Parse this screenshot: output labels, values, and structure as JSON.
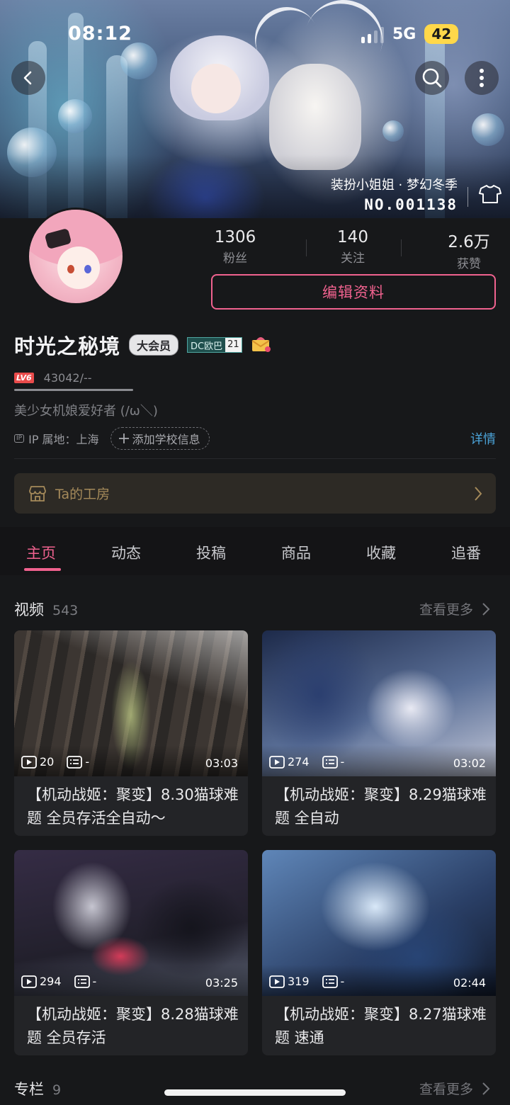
{
  "status": {
    "time": "08:12",
    "network": "5G",
    "battery": "42"
  },
  "costume": {
    "name": "装扮小姐姐 · 梦幻冬季",
    "number": "NO.001138"
  },
  "stats": [
    {
      "value": "1306",
      "label": "粉丝"
    },
    {
      "value": "140",
      "label": "关注"
    },
    {
      "value": "2.6万",
      "label": "获赞"
    }
  ],
  "edit_button": "编辑资料",
  "user": {
    "name": "时光之秘境",
    "vip_badge": "大会员",
    "dc_label": "DC欧巴",
    "dc_number": "21",
    "level": "LV6",
    "exp": "43042/--",
    "signature": "美少女机娘爱好者 (/ω＼)",
    "ip_badge": "IP",
    "ip_location": "IP 属地：上海",
    "school_button": "添加学校信息",
    "detail_link": "详情"
  },
  "workshop": {
    "label": "Ta的工房"
  },
  "tabs": [
    "主页",
    "动态",
    "投稿",
    "商品",
    "收藏",
    "追番"
  ],
  "active_tab": 0,
  "videos_section": {
    "title": "视频",
    "count": "543",
    "more": "查看更多"
  },
  "videos": [
    {
      "plays": "20",
      "danmaku": "-",
      "duration": "03:03",
      "title": "【机动战姬：聚变】8.30猫球难题 全员存活全自动～"
    },
    {
      "plays": "274",
      "danmaku": "-",
      "duration": "03:02",
      "title": "【机动战姬：聚变】8.29猫球难题 全自动"
    },
    {
      "plays": "294",
      "danmaku": "-",
      "duration": "03:25",
      "title": "【机动战姬：聚变】8.28猫球难题 全员存活"
    },
    {
      "plays": "319",
      "danmaku": "-",
      "duration": "02:44",
      "title": "【机动战姬：聚变】8.27猫球难题 速通"
    }
  ],
  "column_section": {
    "title": "专栏",
    "count": "9",
    "more": "查看更多"
  },
  "colors": {
    "accent": "#f0628f",
    "link": "#4ba3d8",
    "workshop_text": "#a58a5a",
    "background": "#17181a"
  }
}
